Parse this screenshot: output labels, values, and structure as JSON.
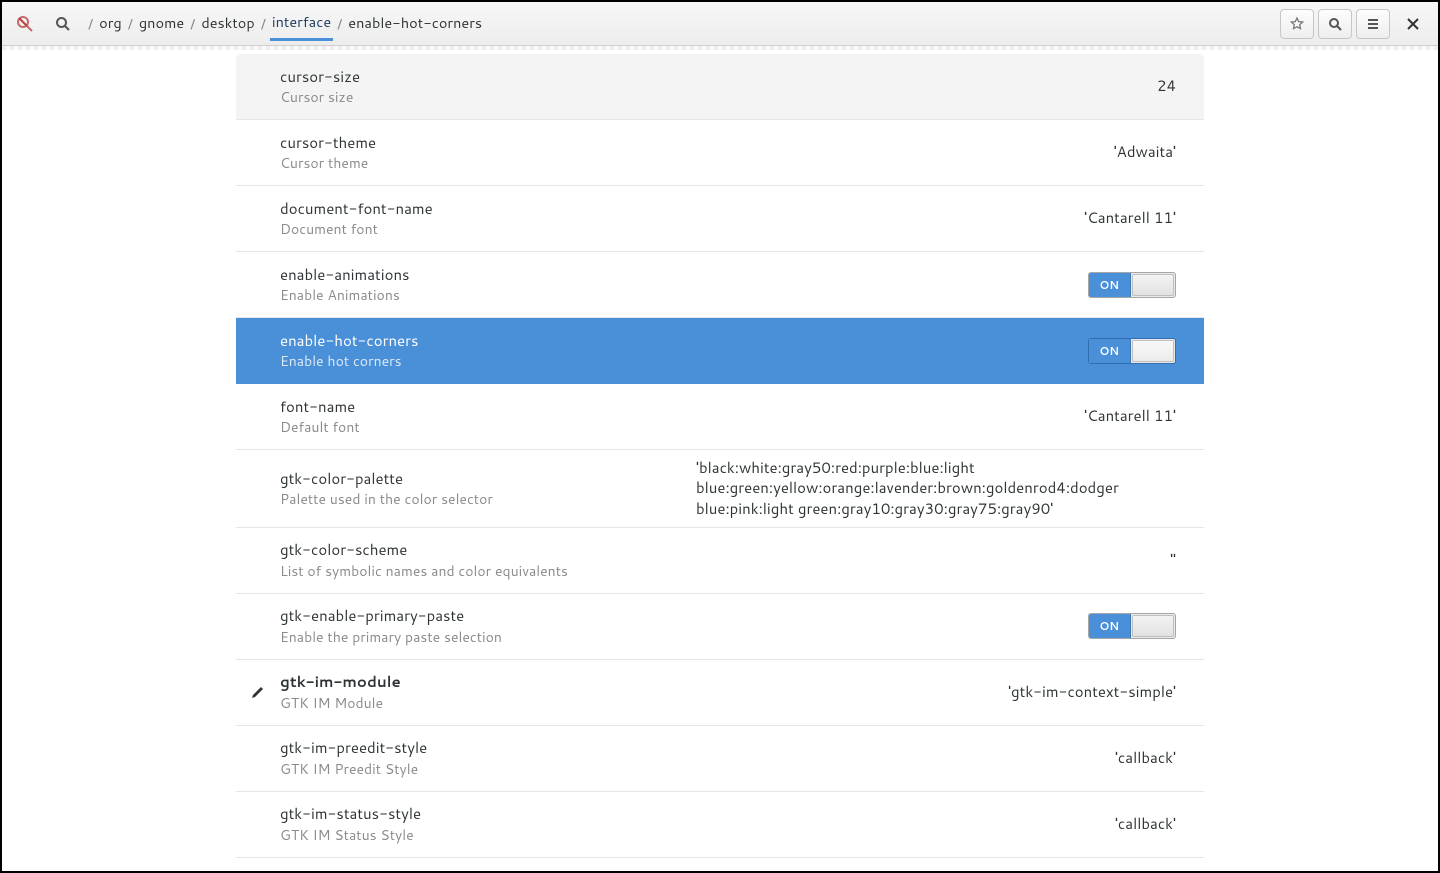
{
  "breadcrumb": {
    "root": "/",
    "parts": [
      "org",
      "gnome",
      "desktop",
      "interface",
      "enable-hot-corners"
    ],
    "active_index": 3
  },
  "switch_labels": {
    "on": "ON",
    "off": ""
  },
  "rows": [
    {
      "key": "cursor-size",
      "desc": "Cursor size",
      "value": "24",
      "type": "text",
      "first": true
    },
    {
      "key": "cursor-theme",
      "desc": "Cursor theme",
      "value": "'Adwaita'",
      "type": "text"
    },
    {
      "key": "document-font-name",
      "desc": "Document font",
      "value": "'Cantarell 11'",
      "type": "text"
    },
    {
      "key": "enable-animations",
      "desc": "Enable Animations",
      "value": "ON",
      "type": "switch"
    },
    {
      "key": "enable-hot-corners",
      "desc": "Enable hot corners",
      "value": "ON",
      "type": "switch",
      "selected": true
    },
    {
      "key": "font-name",
      "desc": "Default font",
      "value": "'Cantarell 11'",
      "type": "text"
    },
    {
      "key": "gtk-color-palette",
      "desc": "Palette used in the color selector",
      "value": "'black:white:gray50:red:purple:blue:light blue:green:yellow:orange:lavender:brown:goldenrod4:dodger blue:pink:light green:gray10:gray30:gray75:gray90'",
      "type": "text",
      "long": true
    },
    {
      "key": "gtk-color-scheme",
      "desc": "List of symbolic names and color equivalents",
      "value": "''",
      "type": "text"
    },
    {
      "key": "gtk-enable-primary-paste",
      "desc": "Enable the primary paste selection",
      "value": "ON",
      "type": "switch"
    },
    {
      "key": "gtk-im-module",
      "desc": "GTK IM Module",
      "value": "'gtk-im-context-simple'",
      "type": "text",
      "bold": true,
      "edited": true
    },
    {
      "key": "gtk-im-preedit-style",
      "desc": "GTK IM Preedit Style",
      "value": "'callback'",
      "type": "text"
    },
    {
      "key": "gtk-im-status-style",
      "desc": "GTK IM Status Style",
      "value": "'callback'",
      "type": "text"
    }
  ]
}
